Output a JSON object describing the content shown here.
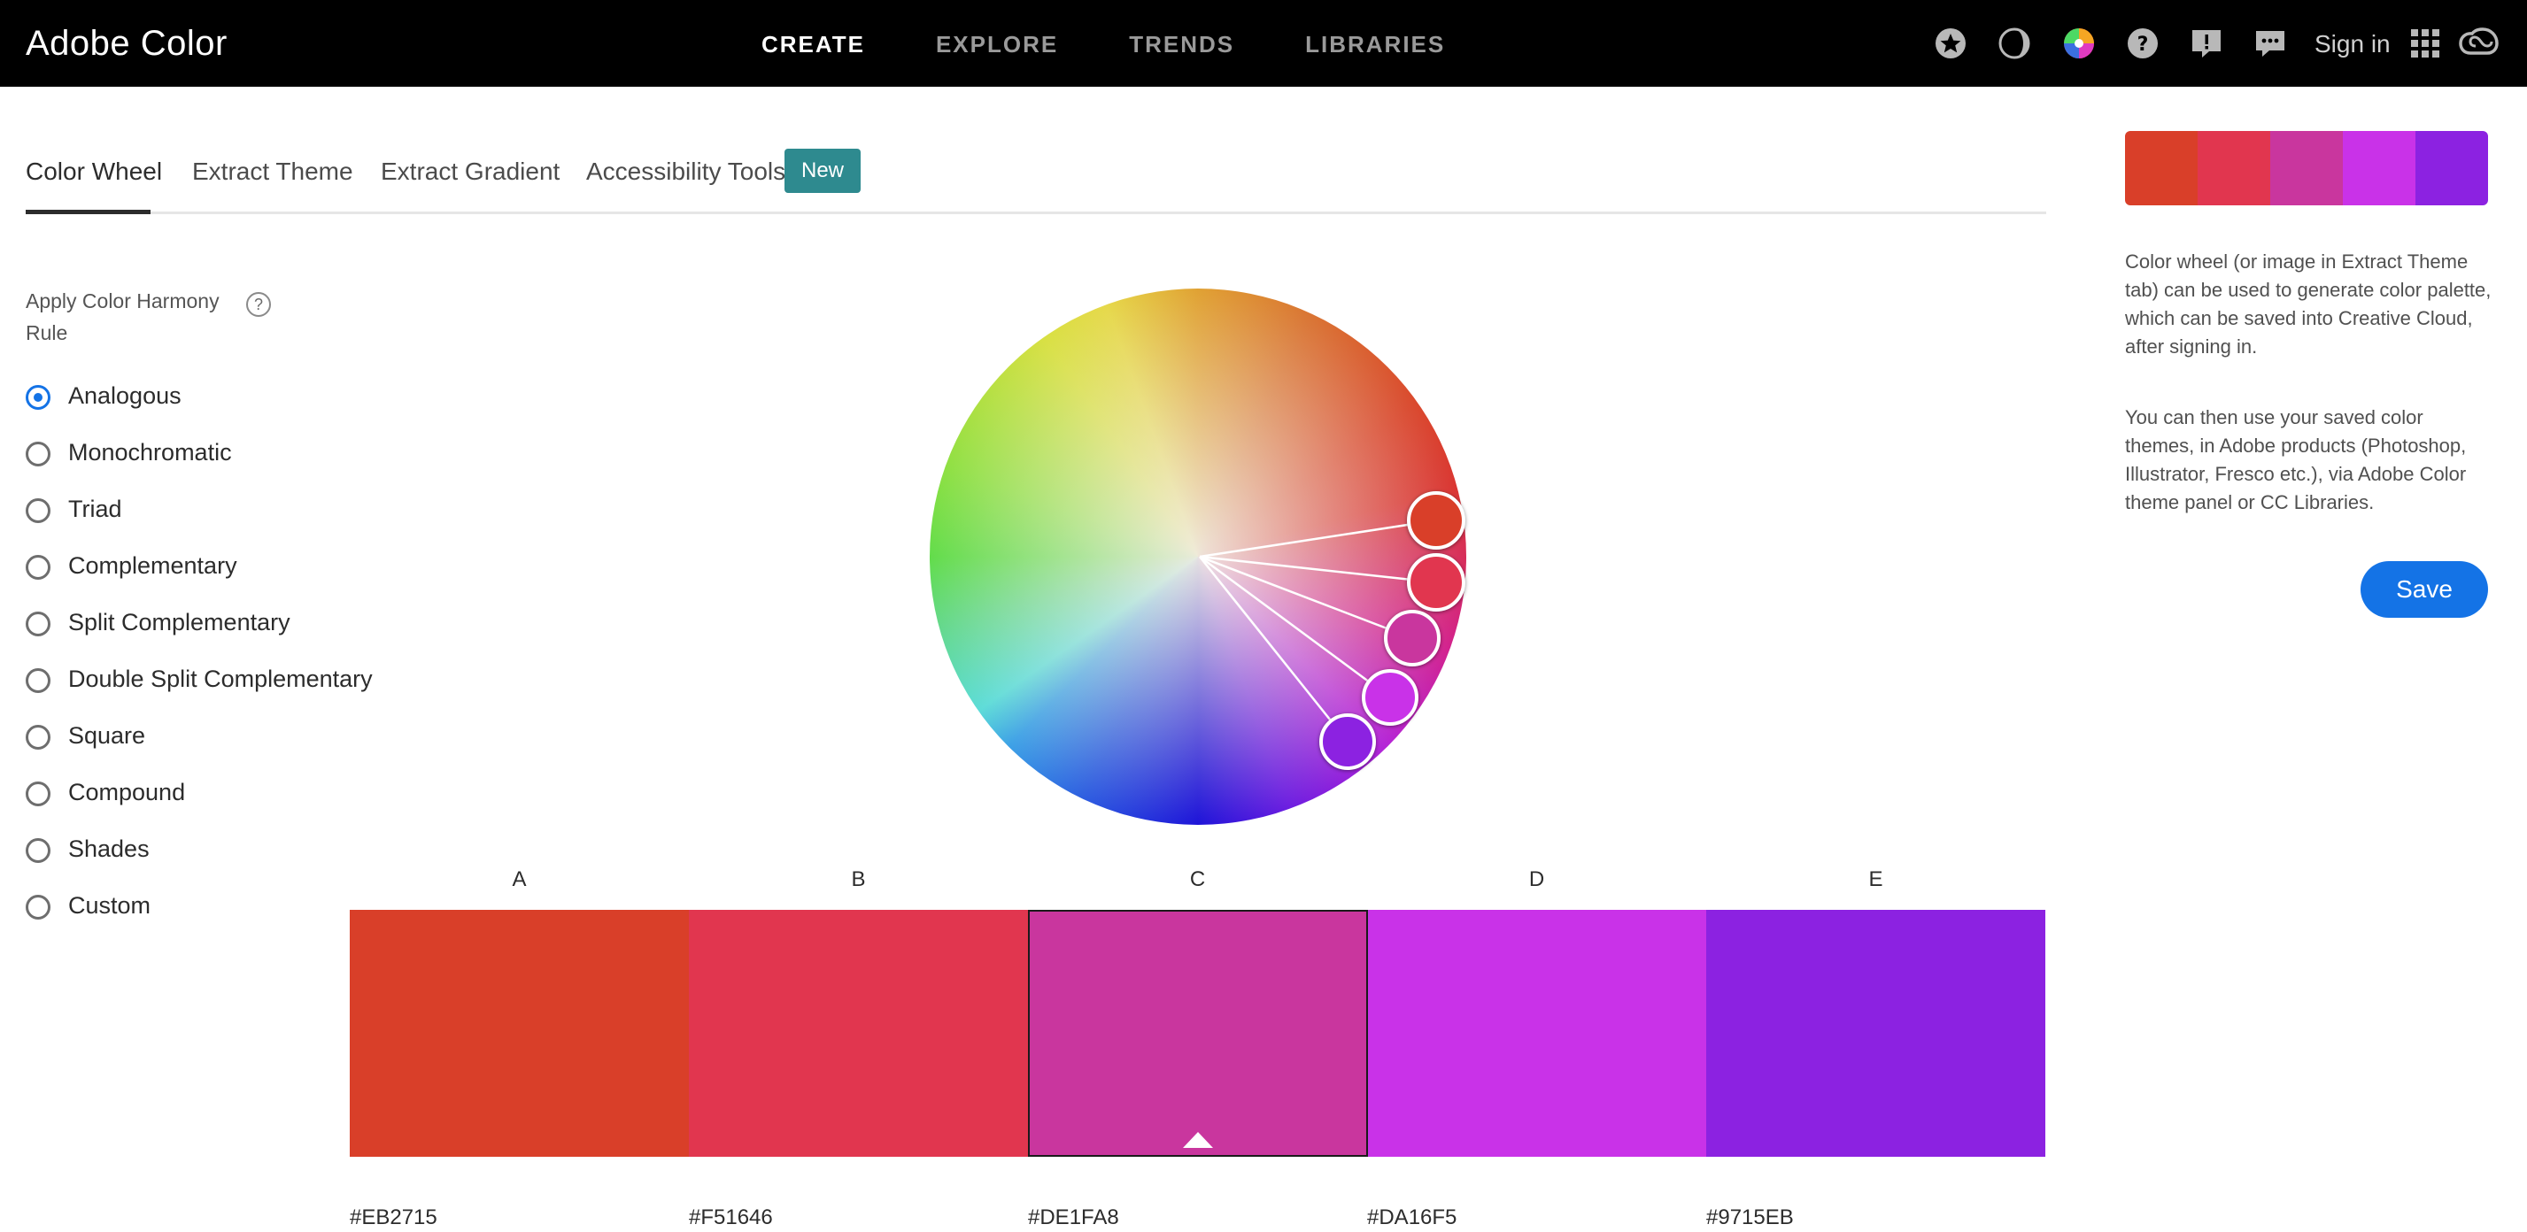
{
  "header": {
    "brand": "Adobe Color",
    "nav": [
      {
        "label": "CREATE",
        "active": true
      },
      {
        "label": "EXPLORE",
        "active": false
      },
      {
        "label": "TRENDS",
        "active": false
      },
      {
        "label": "LIBRARIES",
        "active": false
      }
    ],
    "icons": [
      "star-icon",
      "theme-toggle-icon",
      "color-wheel-icon",
      "help-icon",
      "feedback-alert-icon",
      "chat-icon",
      "apps-grid-icon",
      "creative-cloud-icon"
    ],
    "sign_in": "Sign in"
  },
  "subtabs": {
    "items": [
      "Color Wheel",
      "Extract Theme",
      "Extract Gradient",
      "Accessibility Tools"
    ],
    "active": "Color Wheel",
    "badge": "New"
  },
  "harmony": {
    "label": "Apply Color Harmony Rule",
    "help": "?",
    "rules": [
      "Analogous",
      "Monochromatic",
      "Triad",
      "Complementary",
      "Split Complementary",
      "Double Split Complementary",
      "Square",
      "Compound",
      "Shades",
      "Custom"
    ],
    "selected": "Analogous"
  },
  "swatches": [
    {
      "letter": "A",
      "hex": "#EB2715",
      "color": "#d93f29"
    },
    {
      "letter": "B",
      "hex": "#F51646",
      "color": "#e1364f"
    },
    {
      "letter": "C",
      "hex": "#DE1FA8",
      "color": "#c9369e",
      "selected": true
    },
    {
      "letter": "D",
      "hex": "#DA16F5",
      "color": "#c932e8"
    },
    {
      "letter": "E",
      "hex": "#9715EB",
      "color": "#8c22e1"
    }
  ],
  "sidebar": {
    "description_1": "Color wheel (or image in Extract Theme tab) can be used to generate color palette, which can be saved into Creative Cloud, after signing in.",
    "description_2": "You can then use your saved color themes, in Adobe products (Photoshop, Illustrator, Fresco etc.), via Adobe Color theme panel or CC Libraries.",
    "save_label": "Save"
  }
}
